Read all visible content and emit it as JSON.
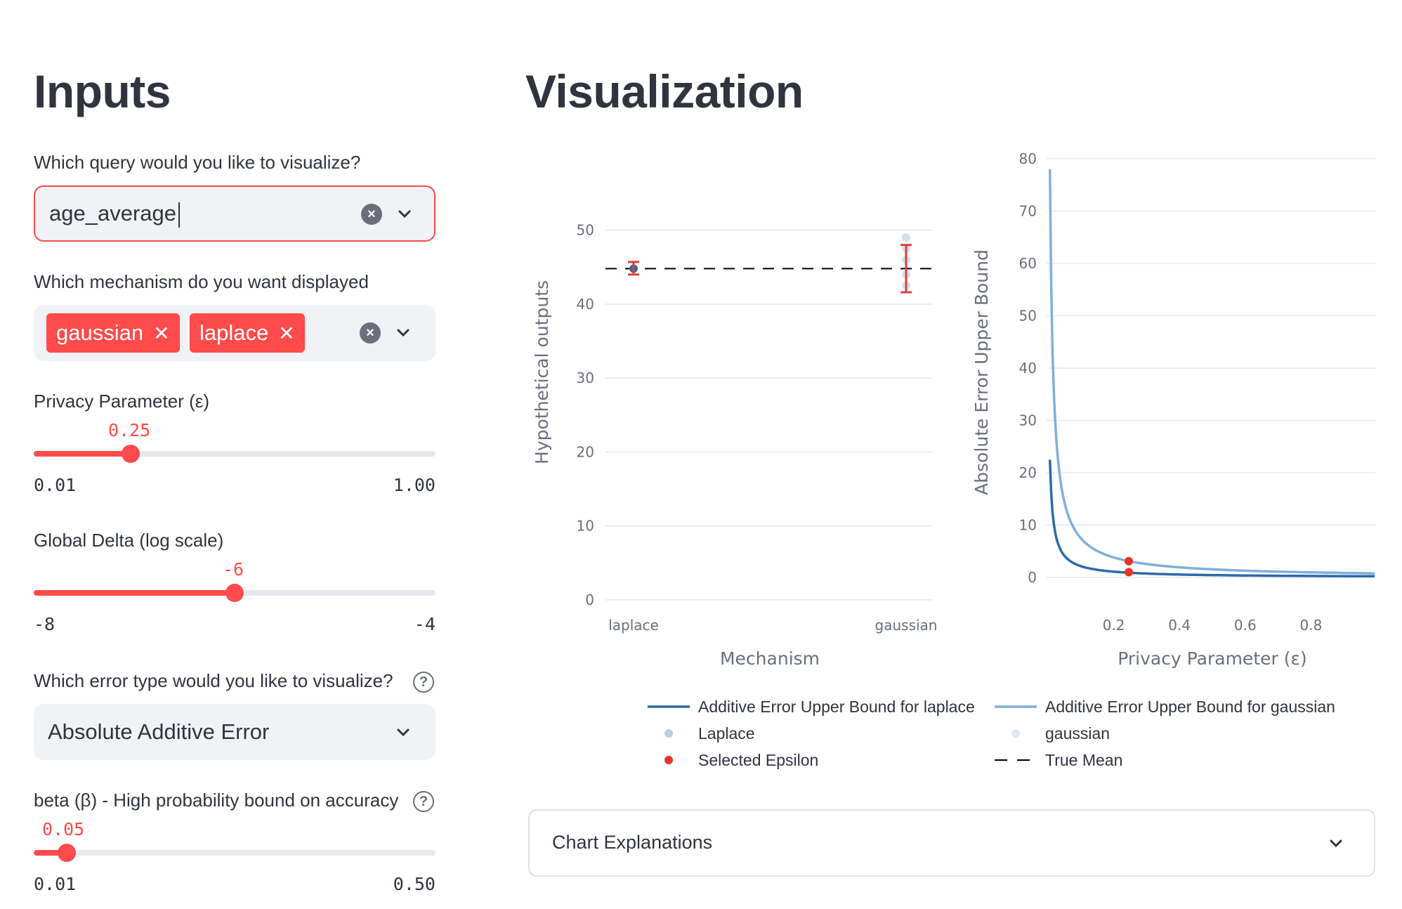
{
  "inputs": {
    "heading": "Inputs",
    "query": {
      "label": "Which query would you like to visualize?",
      "value": "age_average"
    },
    "mechanism": {
      "label": "Which mechanism do you want displayed",
      "tags": [
        "gaussian",
        "laplace"
      ]
    },
    "epsilon": {
      "label": "Privacy Parameter (ε)",
      "value": "0.25",
      "min": "0.01",
      "max": "1.00",
      "fraction": 0.242
    },
    "delta": {
      "label": "Global Delta (log scale)",
      "value": "-6",
      "min": "-8",
      "max": "-4",
      "fraction": 0.5
    },
    "error_type": {
      "label": "Which error type would you like to visualize?",
      "value": "Absolute Additive Error"
    },
    "beta": {
      "label": "beta (β) - High probability bound on accuracy",
      "value": "0.05",
      "min": "0.01",
      "max": "0.50",
      "fraction": 0.082
    }
  },
  "visualization": {
    "heading": "Visualization",
    "expander_label": "Chart Explanations"
  },
  "colors": {
    "accent": "#ff4b4b",
    "laplace_line": "#2c6aa7",
    "gaussian_line": "#7fb0d9",
    "selected": "#e8332a"
  },
  "chart_data": [
    {
      "type": "scatter",
      "xlabel": "Mechanism",
      "ylabel": "Hypothetical outputs",
      "categories": [
        "laplace",
        "gaussian"
      ],
      "ylim": [
        0,
        55
      ],
      "yticks": [
        0,
        10,
        20,
        30,
        40,
        50
      ],
      "true_mean": 44.8,
      "points": [
        {
          "category": "laplace",
          "value": 44.8,
          "err_low": 44.0,
          "err_high": 45.7
        },
        {
          "category": "gaussian",
          "value": 44.8,
          "err_low": 41.6,
          "err_high": 48.0
        }
      ]
    },
    {
      "type": "line",
      "xlabel": "Privacy Parameter (ε)",
      "ylabel": "Absolute Error Upper Bound",
      "xlim": [
        0,
        1
      ],
      "ylim": [
        0,
        80
      ],
      "xticks": [
        0.2,
        0.4,
        0.6,
        0.8
      ],
      "yticks": [
        0,
        10,
        20,
        30,
        40,
        50,
        60,
        70,
        80
      ],
      "series": [
        {
          "name": "Additive Error Upper Bound for laplace",
          "formula": "5.6/eps",
          "selected": {
            "x": 0.25,
            "y": 1.0
          }
        },
        {
          "name": "Additive Error Upper Bound for gaussian",
          "formula": "0.78/eps",
          "selected": {
            "x": 0.25,
            "y": 3.1
          }
        }
      ],
      "legend": [
        "Additive Error Upper Bound for laplace",
        "Additive Error Upper Bound for gaussian",
        "Laplace",
        "gaussian",
        "Selected Epsilon",
        "True Mean"
      ]
    }
  ]
}
